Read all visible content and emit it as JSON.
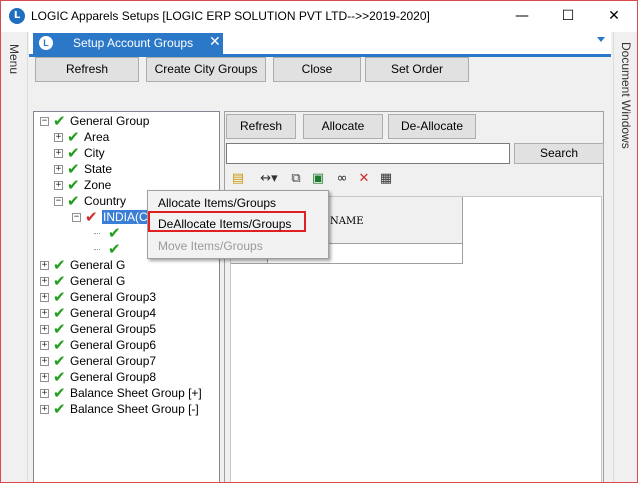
{
  "window": {
    "title": "LOGIC Apparels Setups  [LOGIC ERP SOLUTION PVT LTD-->>2019-2020]",
    "app_icon": "L",
    "minimize": "—",
    "maximize": "☐",
    "close": "✕"
  },
  "left_strip": {
    "label": "Menu"
  },
  "right_strip": {
    "label": "Document Windows"
  },
  "tab": {
    "label": "Setup Account Groups",
    "close": "✕",
    "icon": "L"
  },
  "toolbar_top": {
    "refresh": "Refresh",
    "create_city_groups": "Create City Groups",
    "close": "Close",
    "set_order": "Set Order"
  },
  "right_toolbar": {
    "refresh": "Refresh",
    "allocate": "Allocate",
    "deallocate": "De-Allocate"
  },
  "search": {
    "button": "Search",
    "value": ""
  },
  "grid": {
    "column": "NAME"
  },
  "tree": {
    "root": "General Group",
    "children": [
      "Area",
      "City",
      "State",
      "Zone",
      "Country"
    ],
    "country_child": "INDIA(CU)",
    "siblings": [
      "General Group1",
      "General Group2",
      "General Group3",
      "General Group4",
      "General Group5",
      "General Group6",
      "General Group7",
      "General Group8",
      "Balance Sheet Group [+]",
      "Balance Sheet Group [-]"
    ],
    "sibling_visible_labels": [
      "General G",
      "General G"
    ]
  },
  "context_menu": {
    "items": [
      {
        "label": "Allocate Items/Groups",
        "enabled": true
      },
      {
        "label": "DeAllocate Items/Groups",
        "enabled": true,
        "highlighted": true
      },
      {
        "label": "Move Items/Groups",
        "enabled": false
      }
    ]
  },
  "colors": {
    "accent": "#2b78c8",
    "check_green": "#1aa01a",
    "check_red": "#d22a2a",
    "highlight_border": "#e02020",
    "selected_bg": "#3a7fd5"
  },
  "icons": {
    "toolbar": [
      "edit-icon",
      "column-width-icon",
      "copy-icon",
      "excel-icon",
      "binoculars-icon",
      "delete-icon",
      "grid-icon"
    ]
  }
}
